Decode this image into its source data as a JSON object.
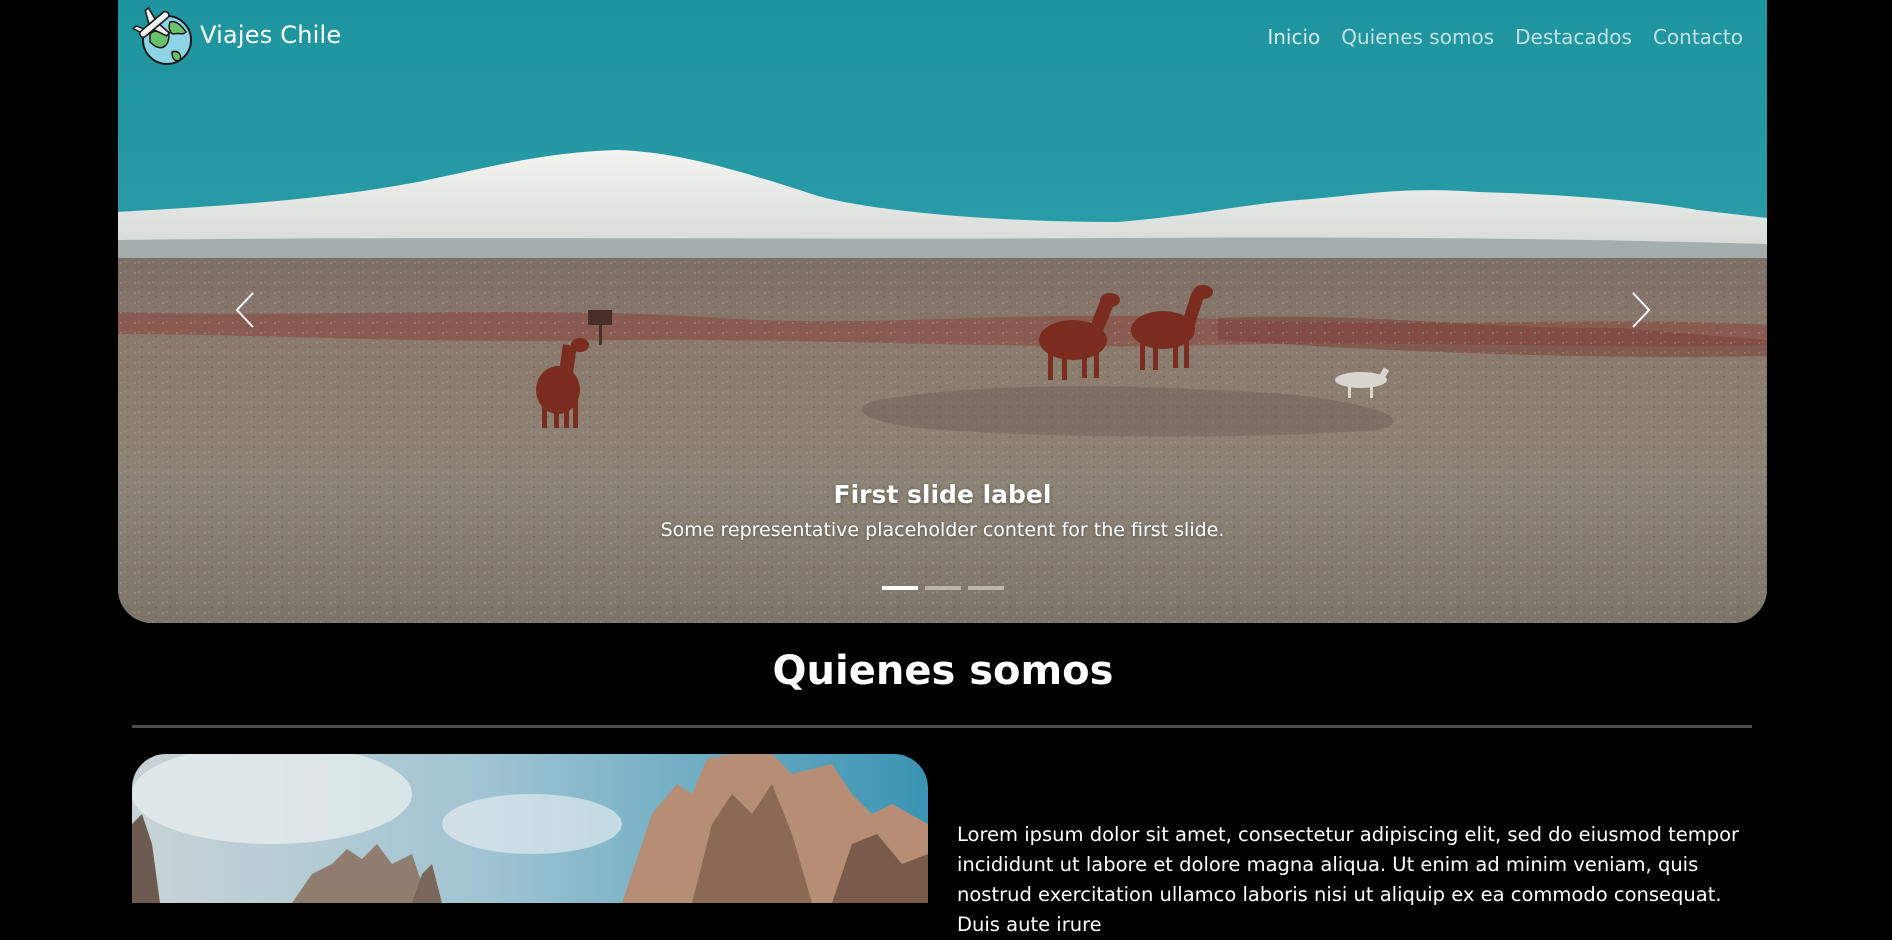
{
  "brand": {
    "name": "Viajes Chile"
  },
  "nav": {
    "items": [
      {
        "label": "Inicio"
      },
      {
        "label": "Quienes somos"
      },
      {
        "label": "Destacados"
      },
      {
        "label": "Contacto"
      }
    ]
  },
  "carousel": {
    "caption_title": "First slide label",
    "caption_text": "Some representative placeholder content for the first slide.",
    "indicator_count": 3,
    "active_indicator": 1
  },
  "about": {
    "title": "Quienes somos",
    "paragraph": "Lorem ipsum dolor sit amet, consectetur adipiscing elit, sed do eiusmod tempor incididunt ut labore et dolore magna aliqua. Ut enim ad minim veniam, quis nostrud exercitation ullamco laboris nisi ut aliquip ex ea commodo consequat. Duis aute irure"
  },
  "colors": {
    "page_bg": "#000000",
    "sky": "#1f98a0",
    "divider": "#4a4a4a",
    "text": "#ffffff"
  },
  "icons": {
    "logo": "globe-airplane-logo",
    "prev": "chevron-left-icon",
    "next": "chevron-right-icon"
  }
}
